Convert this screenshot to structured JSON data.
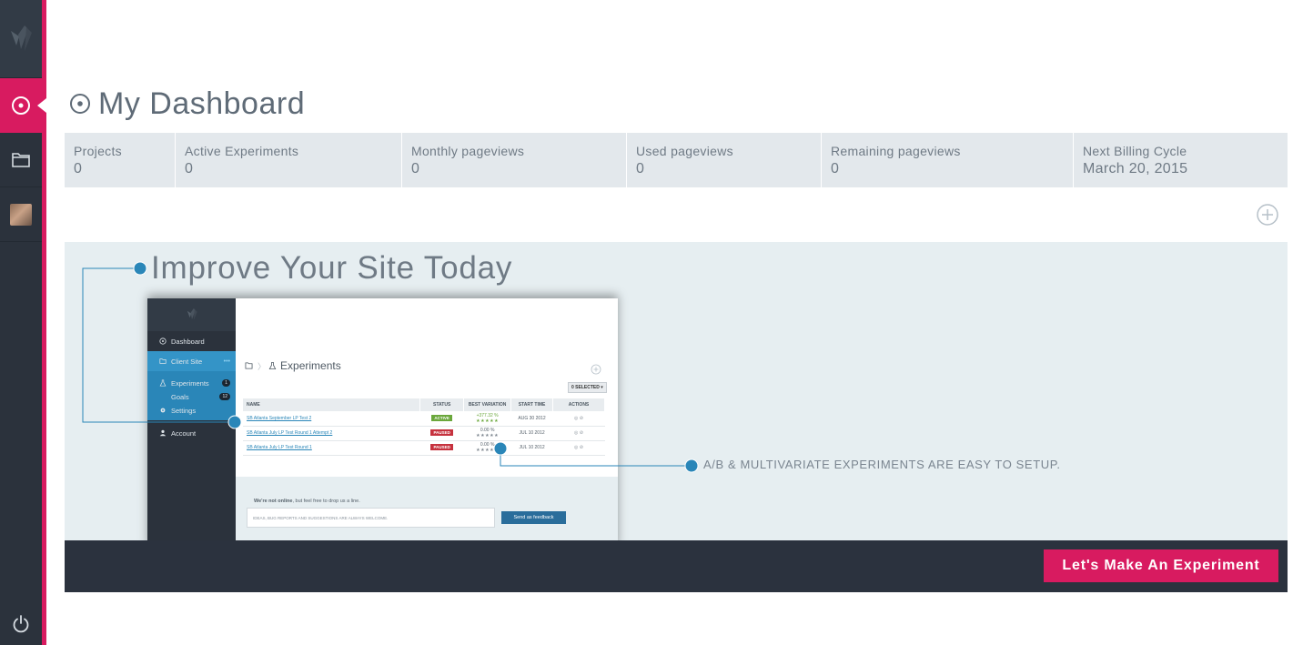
{
  "sidebar": {
    "items": [
      {
        "name": "dashboard",
        "icon": "dashboard-icon",
        "active": true
      },
      {
        "name": "projects",
        "icon": "folder-icon",
        "active": false
      },
      {
        "name": "profile",
        "icon": "avatar",
        "active": false
      }
    ],
    "accent_color": "#d81b60"
  },
  "page": {
    "title": "My Dashboard"
  },
  "stats": [
    {
      "label": "Projects",
      "value": "0"
    },
    {
      "label": "Active Experiments",
      "value": "0"
    },
    {
      "label": "Monthly pageviews",
      "value": "0"
    },
    {
      "label": "Used pageviews",
      "value": "0"
    },
    {
      "label": "Remaining pageviews",
      "value": "0"
    },
    {
      "label": "Next Billing Cycle",
      "value": "March 20, 2015"
    }
  ],
  "promo": {
    "title": "Improve Your Site Today",
    "callout": "A/B & MULTIVARIATE EXPERIMENTS ARE EASY TO SETUP.",
    "cta_label": "Let's Make An Experiment"
  },
  "mini": {
    "nav": {
      "dashboard": "Dashboard",
      "client_site": "Client Site",
      "experiments": "Experiments",
      "experiments_count": "1",
      "goals": "Goals",
      "goals_count": "12",
      "settings": "Settings",
      "account": "Account"
    },
    "experiments_title": "Experiments",
    "selected_label": "0 SELECTED ▾",
    "table": {
      "headers": [
        "NAME",
        "STATUS",
        "BEST VARIATION",
        "START TIME",
        "ACTIONS"
      ],
      "rows": [
        {
          "name": "SB Atlanta September LP Test 2",
          "status": "ACTIVE",
          "variation": "+377.32 %",
          "start": "AUG 30 2012"
        },
        {
          "name": "SB Atlanta July LP Test Round 1 Attempt 2",
          "status": "PAUSED",
          "variation": "0.00 %",
          "start": "JUL 10 2012"
        },
        {
          "name": "SB Atlanta July LP Test Round 1",
          "status": "PAUSED",
          "variation": "0.00 %",
          "start": "JUL 10 2012"
        }
      ]
    },
    "feedback": {
      "bold": "We're not online",
      "rest": ", but feel free to drop us a line.",
      "placeholder": "IDEAS, BUG REPORTS AND SUGGESTIONS ARE ALWAYS WELCOME.",
      "button": "Send as feedback"
    }
  }
}
